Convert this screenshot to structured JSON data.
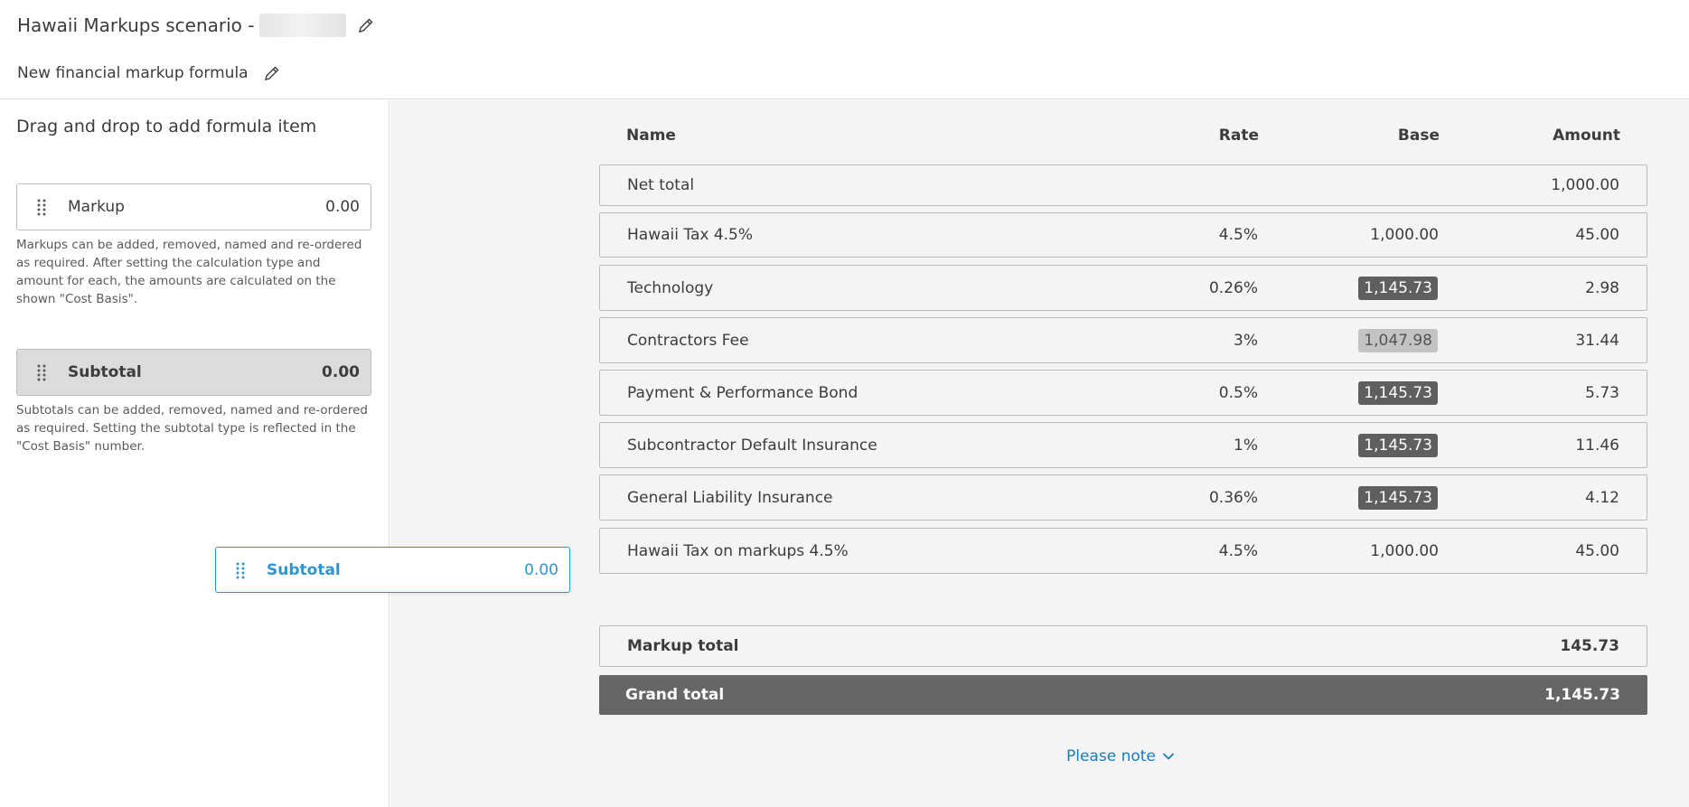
{
  "header": {
    "scenario_title": "Hawaii Markups scenario -",
    "formula_name": "New financial markup formula"
  },
  "palette": {
    "heading": "Drag and drop to add formula item",
    "markup": {
      "label": "Markup",
      "value": "0.00",
      "help": "Markups can be added, removed, named and re-ordered as required. After setting the calculation type and amount for each, the amounts are calculated on the shown \"Cost Basis\"."
    },
    "subtotal": {
      "label": "Subtotal",
      "value": "0.00",
      "help": "Subtotals can be added, removed, named and re-ordered as required. Setting the subtotal type is reflected in the \"Cost Basis\" number."
    }
  },
  "dragging_item": {
    "label": "Subtotal",
    "value": "0.00"
  },
  "table": {
    "columns": {
      "name": "Name",
      "rate": "Rate",
      "base": "Base",
      "amount": "Amount"
    },
    "net_total": {
      "name": "Net total",
      "amount": "1,000.00"
    },
    "rows": [
      {
        "name": "Hawaii Tax 4.5%",
        "rate": "4.5%",
        "base": "1,000.00",
        "base_style": "plain",
        "amount": "45.00"
      },
      {
        "name": "Technology",
        "rate": "0.26%",
        "base": "1,145.73",
        "base_style": "dark",
        "amount": "2.98"
      },
      {
        "name": "Contractors Fee",
        "rate": "3%",
        "base": "1,047.98",
        "base_style": "light",
        "amount": "31.44"
      },
      {
        "name": "Payment & Performance Bond",
        "rate": "0.5%",
        "base": "1,145.73",
        "base_style": "dark",
        "amount": "5.73"
      },
      {
        "name": "Subcontractor Default Insurance",
        "rate": "1%",
        "base": "1,145.73",
        "base_style": "dark",
        "amount": "11.46"
      },
      {
        "name": "General Liability Insurance",
        "rate": "0.36%",
        "base": "1,145.73",
        "base_style": "dark",
        "amount": "4.12"
      },
      {
        "name": "Hawaii Tax on markups 4.5%",
        "rate": "4.5%",
        "base": "1,000.00",
        "base_style": "plain",
        "amount": "45.00"
      }
    ],
    "markup_total": {
      "label": "Markup total",
      "amount": "145.73"
    },
    "grand_total": {
      "label": "Grand total",
      "amount": "1,145.73"
    }
  },
  "please_note": "Please note",
  "colors": {
    "accent": "#2d95cf",
    "link": "#1a7bb8",
    "grand_total_bg": "#666666",
    "chip_dark": "#5f5f5f",
    "chip_light": "#c3c3c3"
  },
  "icons": [
    "pencil-icon",
    "drag-handle-icon",
    "chevron-down-icon"
  ]
}
